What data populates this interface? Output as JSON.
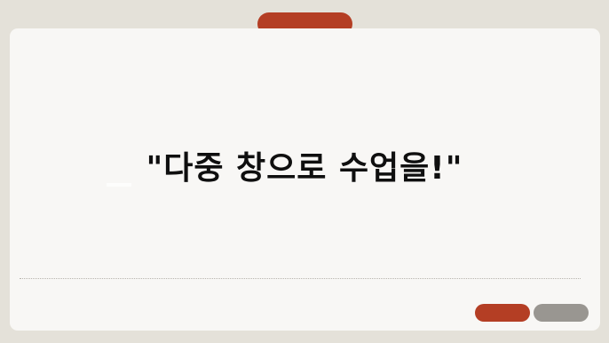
{
  "slide": {
    "headline": "\"다중 창으로 수업을!\""
  },
  "colors": {
    "accent": "#b43e24",
    "secondary": "#999691",
    "background": "#e4e1d9",
    "card": "#f8f7f5",
    "text": "#0f0f0f"
  }
}
